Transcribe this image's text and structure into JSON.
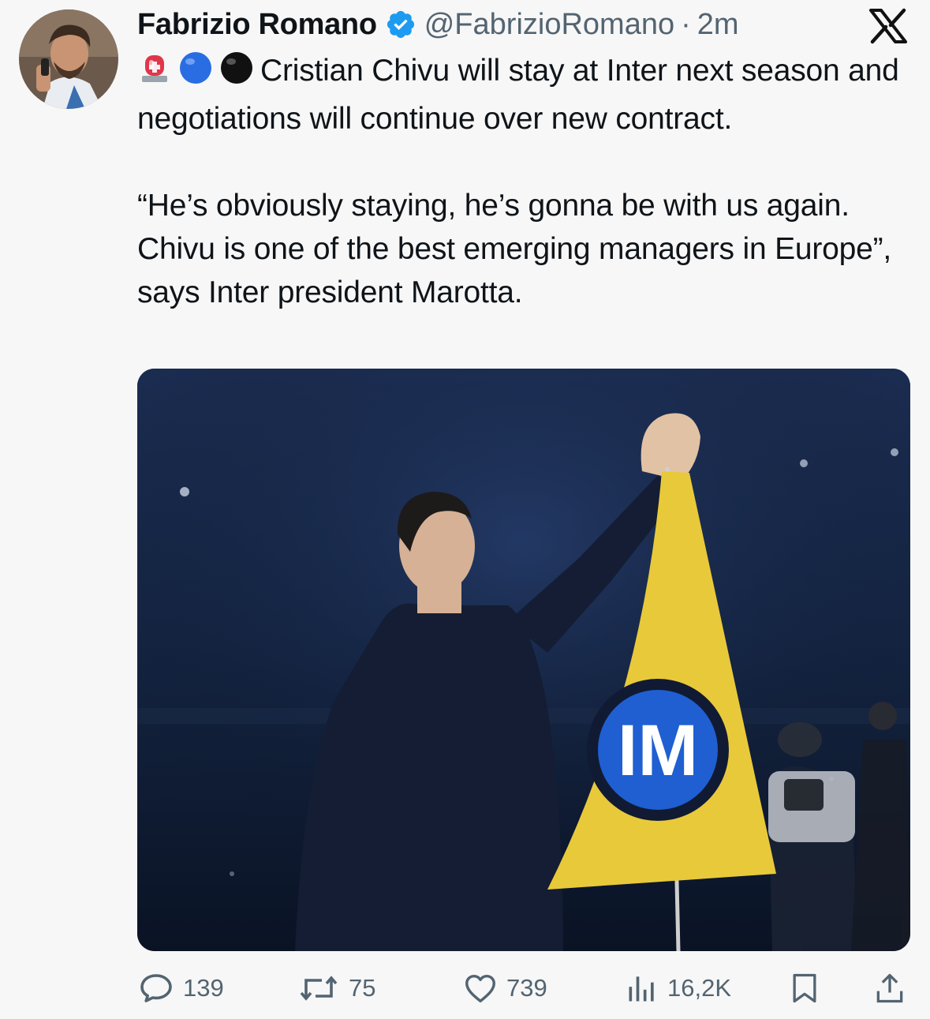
{
  "tweet": {
    "author": {
      "display_name": "Fabrizio Romano",
      "handle": "@FabrizioRomano",
      "verified": true,
      "avatar_icon": "profile-photo"
    },
    "separator": "·",
    "time": "2m",
    "platform_icon": "x-logo-icon",
    "emojis": [
      "rotating-light-emoji",
      "blue-circle-emoji",
      "black-circle-emoji"
    ],
    "text_line1": "Cristian Chivu will stay at Inter next season and negotiations will continue over new contract.",
    "text_line2": "“He’s obviously staying, he’s gonna be with us again. Chivu is one of the best emerging managers in Europe”, says Inter president Marotta.",
    "media": {
      "type": "photo",
      "logo_text": "IM"
    },
    "stats": {
      "replies": "139",
      "reposts": "75",
      "likes": "739",
      "views": "16,2K"
    },
    "colors": {
      "accent": "#1d9bf0",
      "muted": "#536471",
      "flag": "#e8c93a",
      "inter_blue": "#1f5fd1"
    }
  }
}
